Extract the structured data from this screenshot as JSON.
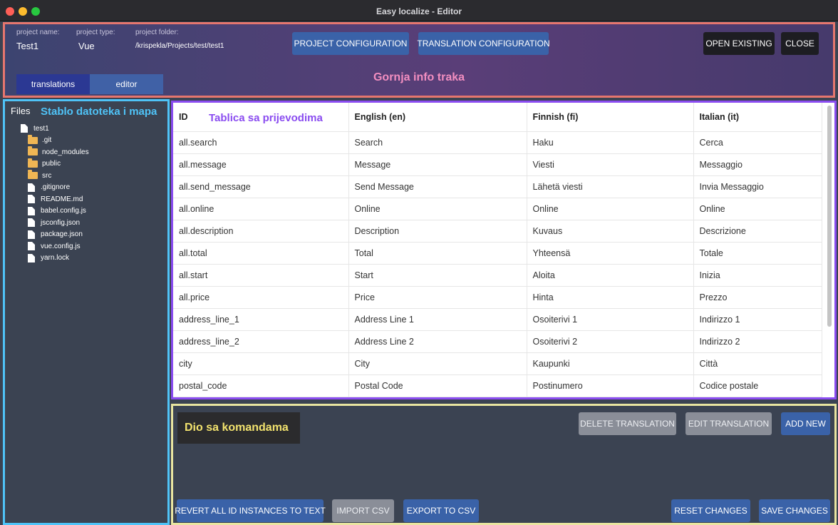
{
  "window": {
    "title": "Easy localize - Editor"
  },
  "header": {
    "project_name_label": "project name:",
    "project_name": "Test1",
    "project_type_label": "project type:",
    "project_type": "Vue",
    "project_folder_label": "project folder:",
    "project_folder": "/krispekla/Projects/test/test1",
    "buttons": {
      "project_configuration": "PROJECT CONFIGURATION",
      "translation_configuration": "TRANSLATION CONFIGURATION",
      "open_existing": "OPEN EXISTING",
      "close": "CLOSE"
    },
    "tabs": [
      "translations",
      "editor"
    ],
    "annotation": "Gornja info traka"
  },
  "sidebar": {
    "label": "Files",
    "annotation": "Stablo datoteka i mapa",
    "tree": [
      {
        "name": "test1",
        "type": "file",
        "level": 0
      },
      {
        "name": ".git",
        "type": "folder",
        "level": 1
      },
      {
        "name": "node_modules",
        "type": "folder",
        "level": 1
      },
      {
        "name": "public",
        "type": "folder",
        "level": 1
      },
      {
        "name": "src",
        "type": "folder",
        "level": 1
      },
      {
        "name": ".gitignore",
        "type": "file",
        "level": 1
      },
      {
        "name": "README.md",
        "type": "file",
        "level": 1
      },
      {
        "name": "babel.config.js",
        "type": "file",
        "level": 1
      },
      {
        "name": "jsconfig.json",
        "type": "file",
        "level": 1
      },
      {
        "name": "package.json",
        "type": "file",
        "level": 1
      },
      {
        "name": "vue.config.js",
        "type": "file",
        "level": 1
      },
      {
        "name": "yarn.lock",
        "type": "file",
        "level": 1
      }
    ]
  },
  "table": {
    "annotation": "Tablica sa prijevodima",
    "columns": [
      "ID",
      "English (en)",
      "Finnish (fi)",
      "Italian (it)"
    ],
    "rows": [
      [
        "all.search",
        "Search",
        "Haku",
        "Cerca"
      ],
      [
        "all.message",
        "Message",
        "Viesti",
        "Messaggio"
      ],
      [
        "all.send_message",
        "Send Message",
        "Lähetä viesti",
        "Invia Messaggio"
      ],
      [
        "all.online",
        "Online",
        "Online",
        "Online"
      ],
      [
        "all.description",
        "Description",
        "Kuvaus",
        "Descrizione"
      ],
      [
        "all.total",
        "Total",
        "Yhteensä",
        "Totale"
      ],
      [
        "all.start",
        "Start",
        "Aloita",
        "Inizia"
      ],
      [
        "all.price",
        "Price",
        "Hinta",
        "Prezzo"
      ],
      [
        "address_line_1",
        "Address Line 1",
        "Osoiterivi 1",
        "Indirizzo 1"
      ],
      [
        "address_line_2",
        "Address Line 2",
        "Osoiterivi 2",
        "Indirizzo 2"
      ],
      [
        "city",
        "City",
        "Kaupunki",
        "Città"
      ],
      [
        "postal_code",
        "Postal Code",
        "Postinumero",
        "Codice postale"
      ]
    ]
  },
  "commands": {
    "annotation": "Dio sa komandama",
    "delete_translation": "DELETE TRANSLATION",
    "edit_translation": "EDIT TRANSLATION",
    "add_new": "ADD NEW",
    "revert_all": "REVERT ALL ID INSTANCES TO TEXT",
    "import_csv": "IMPORT CSV",
    "export_csv": "EXPORT TO CSV",
    "reset_changes": "RESET CHANGES",
    "save_changes": "SAVE CHANGES"
  }
}
